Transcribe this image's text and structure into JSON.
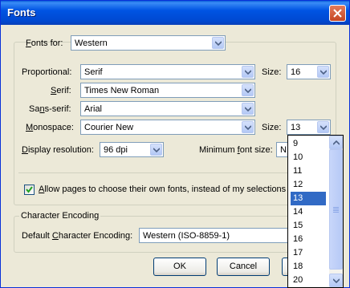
{
  "window": {
    "title": "Fonts"
  },
  "fonts_for": {
    "label": "Fonts for:",
    "value": "Western"
  },
  "proportional": {
    "label": "Proportional:",
    "value": "Serif",
    "size_label": "Size:",
    "size_value": "16"
  },
  "serif": {
    "label": "Serif:",
    "value": "Times New Roman"
  },
  "sans_serif": {
    "label": "Sans-serif:",
    "value": "Arial"
  },
  "monospace": {
    "label": "Monospace:",
    "value": "Courier New",
    "size_label": "Size:",
    "size_value": "13"
  },
  "display_resolution": {
    "label": "Display resolution:",
    "value": "96 dpi"
  },
  "minimum_font_size": {
    "label": "Minimum font size:",
    "value": "N"
  },
  "allow_pages": {
    "label": "Allow pages to choose their own fonts, instead of my selections ab",
    "checked": true
  },
  "character_encoding": {
    "group_label": "Character Encoding",
    "label": "Default Character Encoding:",
    "value": "Western (ISO-8859-1)"
  },
  "buttons": {
    "ok": "OK",
    "cancel": "Cancel"
  },
  "size_dropdown": {
    "options": [
      "9",
      "10",
      "11",
      "12",
      "13",
      "14",
      "15",
      "16",
      "17",
      "18",
      "20"
    ],
    "selected": "13"
  },
  "colors": {
    "titlebar": "#0054e3",
    "selection": "#316ac5",
    "dialog_bg": "#ece9d8"
  }
}
